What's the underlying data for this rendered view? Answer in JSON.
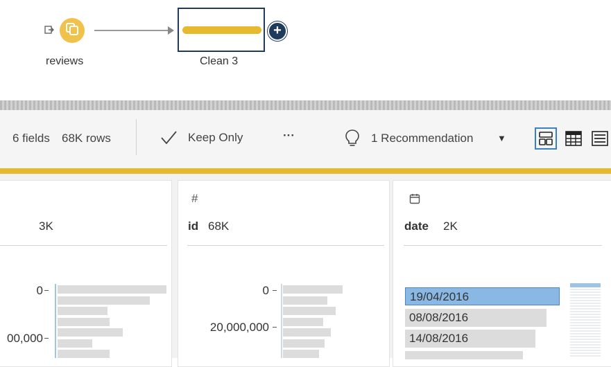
{
  "flow": {
    "input_node": {
      "label": "reviews",
      "icon": "input-arrow-icon"
    },
    "clean_node": {
      "label": "Clean 3"
    },
    "add_step": {
      "icon": "plus-icon",
      "glyph": "+"
    }
  },
  "toolbar": {
    "fields": "6 fields",
    "rows": "68K rows",
    "keep_only": "Keep Only",
    "more": "···",
    "recommendation": "1 Recommendation",
    "dropdown_glyph": "▼"
  },
  "columns": [
    {
      "type_glyph": "",
      "name": "",
      "count": "3K",
      "ticks": [
        "0",
        "00,000"
      ],
      "bars_fraction": [
        1.0,
        0.85,
        0.46,
        0.48,
        0.6,
        0.32,
        0.48
      ]
    },
    {
      "type_glyph": "#",
      "name": "id",
      "count": "68K",
      "ticks": [
        "0",
        "20,000,000"
      ],
      "bars_fraction": [
        1.0,
        0.74,
        0.88,
        0.68,
        0.8,
        0.7,
        0.6
      ]
    },
    {
      "type_glyph": "calendar-icon",
      "name": "date",
      "count": "2K",
      "values": [
        "19/04/2016",
        "08/08/2016",
        "14/08/2016"
      ],
      "selected_index": 0
    }
  ],
  "colors": {
    "accent_yellow": "#e6b92e",
    "node_yellow": "#f0c14b",
    "selection_blue": "#8ab8e4",
    "navy": "#1f3a5a"
  }
}
